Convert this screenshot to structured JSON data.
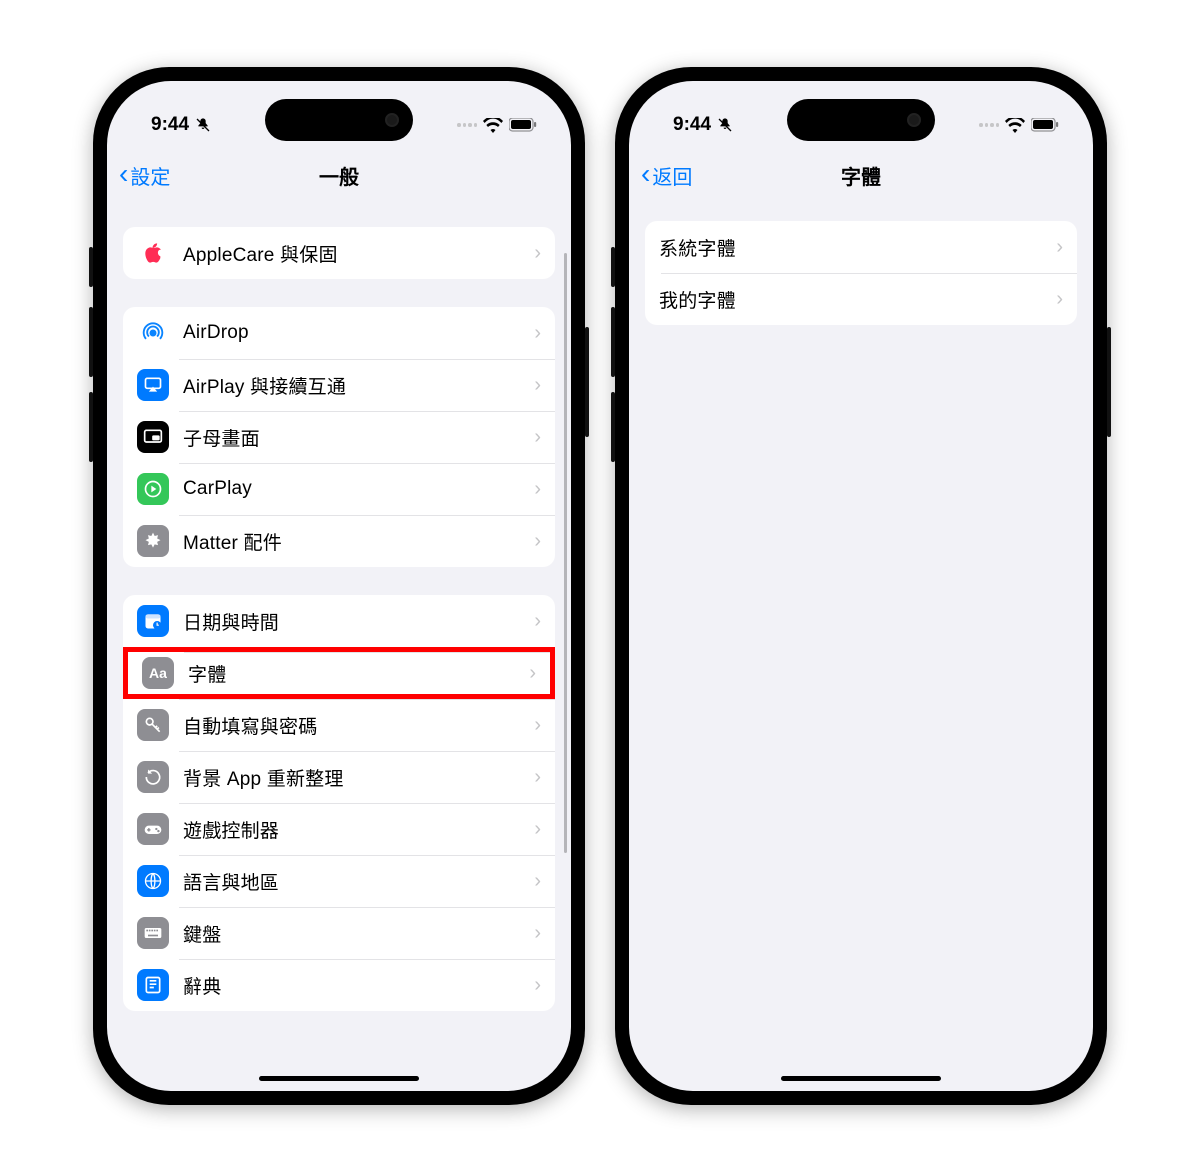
{
  "status": {
    "time": "9:44"
  },
  "left_phone": {
    "back_label": "設定",
    "title": "一般",
    "highlighted_row": "字體",
    "group1": [
      {
        "icon": "apple-logo-icon",
        "bg": "bg-none",
        "label": "AppleCare 與保固"
      }
    ],
    "group2": [
      {
        "icon": "airdrop-icon",
        "bg": "bg-none",
        "label": "AirDrop"
      },
      {
        "icon": "airplay-icon",
        "bg": "bg-blue",
        "label": "AirPlay 與接續互通"
      },
      {
        "icon": "pip-icon",
        "bg": "bg-black",
        "label": "子母畫面"
      },
      {
        "icon": "carplay-icon",
        "bg": "bg-green",
        "label": "CarPlay"
      },
      {
        "icon": "matter-icon",
        "bg": "bg-gray",
        "label": "Matter 配件"
      }
    ],
    "group3": [
      {
        "icon": "calendar-clock-icon",
        "bg": "bg-blue",
        "label": "日期與時間"
      },
      {
        "icon": "fonts-icon",
        "bg": "bg-gray",
        "label": "字體"
      },
      {
        "icon": "key-icon",
        "bg": "bg-gray",
        "label": "自動填寫與密碼"
      },
      {
        "icon": "refresh-icon",
        "bg": "bg-gray",
        "label": "背景 App 重新整理"
      },
      {
        "icon": "gamepad-icon",
        "bg": "bg-gray",
        "label": "遊戲控制器"
      },
      {
        "icon": "globe-icon",
        "bg": "bg-blue",
        "label": "語言與地區"
      },
      {
        "icon": "keyboard-icon",
        "bg": "bg-gray",
        "label": "鍵盤"
      },
      {
        "icon": "book-icon",
        "bg": "bg-blue",
        "label": "辭典"
      }
    ]
  },
  "right_phone": {
    "back_label": "返回",
    "title": "字體",
    "group1": [
      {
        "label": "系統字體"
      },
      {
        "label": "我的字體"
      }
    ]
  }
}
